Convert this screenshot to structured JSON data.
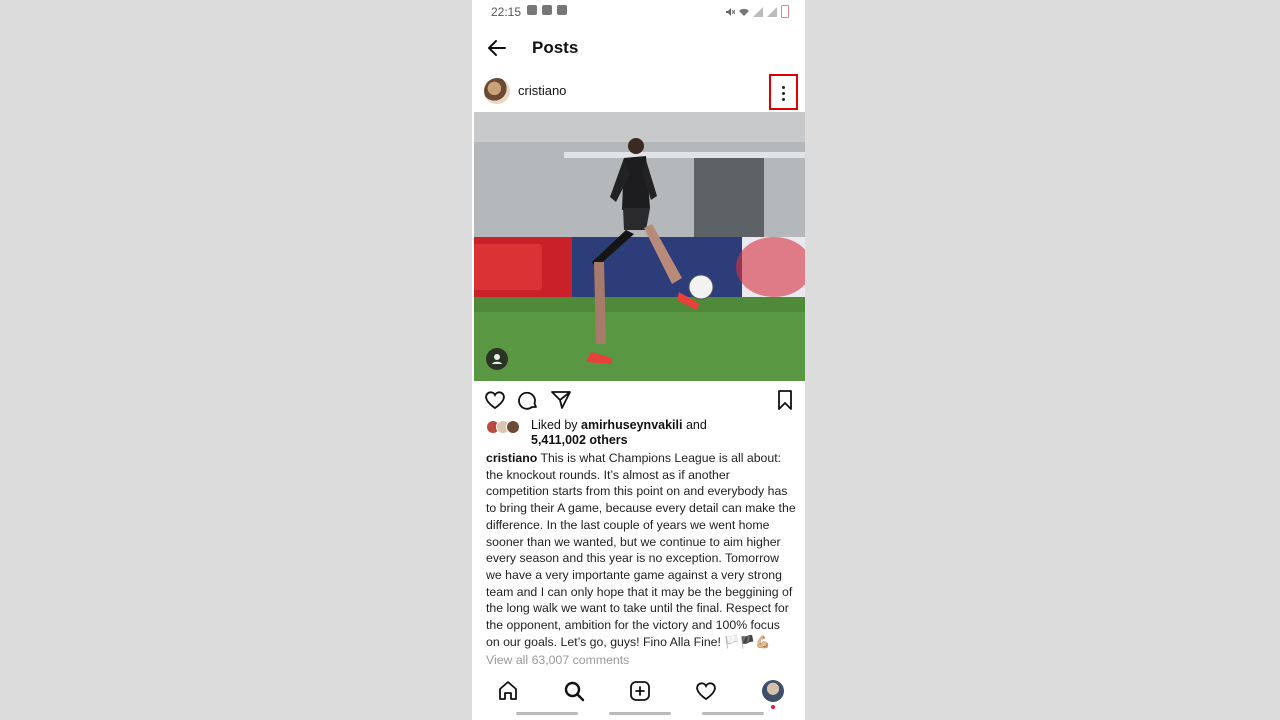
{
  "status_bar": {
    "time": "22:15"
  },
  "header": {
    "title": "Posts"
  },
  "post": {
    "username": "cristiano",
    "icons": {
      "more": "more-vertical-icon",
      "like": "heart-icon",
      "comment": "comment-icon",
      "share": "send-icon",
      "save": "bookmark-icon",
      "tag": "user-tag-icon"
    },
    "likes": {
      "prefix": "Liked by ",
      "user": "amirhuseynvakili",
      "middle": " and",
      "others": "5,411,002 others"
    },
    "caption_username": "cristiano",
    "caption_text": " This is what Champions League is all about: the knockout rounds. It’s almost as if another competition starts from this point on and everybody has to bring their A game, because every detail can make the difference. In the last couple of years we went home sooner than we wanted, but we continue to aim higher every season and this year is no exception. Tomorrow we have a very importante game against a very strong team and I can only hope that it may be the beggining of the long walk we want to take until the final. Respect for the opponent, ambition for the victory and 100% focus on our goals. Let’s go, guys! Fino Alla Fine! 🏳️🏴💪🏼",
    "view_comments": "View all 63,007 comments"
  },
  "bottom_nav": {
    "items": [
      "home-icon",
      "search-icon",
      "create-post-icon",
      "activity-heart-icon",
      "profile-avatar"
    ]
  },
  "colors": {
    "highlight_box": "#e00000",
    "accent_dot": "#e5193a",
    "muted_text": "#999999"
  }
}
